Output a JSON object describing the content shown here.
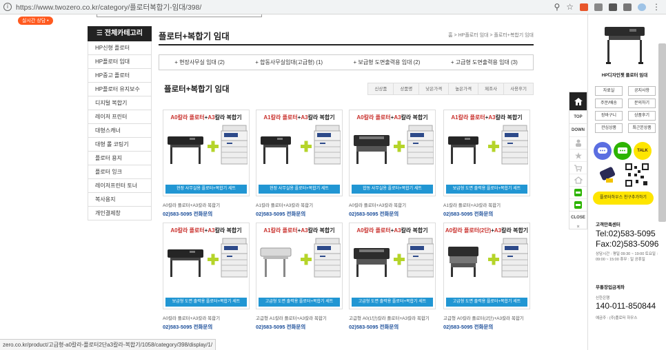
{
  "browser": {
    "url": "https://www.twozero.co.kr/category/플로터복합기-임대/398/"
  },
  "top": {
    "badge": "실시간 상담 •"
  },
  "sidebar": {
    "header": "☰ 전체카테고리",
    "items": [
      "HP신형 플로터",
      "HP플로터 임대",
      "HP중고 플로터",
      "HP플로터 유지보수",
      "디지털 복합기",
      "레이저 프린터",
      "대형스캐너",
      "대형 롤 코팅기",
      "플로터 용지",
      "플로터 잉크",
      "레이저프린터 토너",
      "복사용지",
      "개인결제창"
    ]
  },
  "main": {
    "title": "플로터+복합기 임대",
    "breadcrumb": "홈 > HP플로터 임대 > 플로터+복합기 임대",
    "subcategories": [
      "+ 현장사무실 임대 (2)",
      "+ 합동사무실임대(고급형) (1)",
      "+ 보급형 도면출력용 임대 (2)",
      "+ 고급형 도면출력용 임대 (3)"
    ],
    "list_title": "플로터+복합기 임대",
    "sort_options": [
      "신상품",
      "상품명",
      "낮은가격",
      "높은가격",
      "제조사",
      "사용후기"
    ]
  },
  "products": [
    {
      "t1": "A0칼라 플로터",
      "plus": "+",
      "t2": "A3칼라 복합기",
      "banner": "현장 사무실용 플로터+복합기 세트",
      "name": "A0칼라 플로터+A3칼라 복합기",
      "phone": "02)583-5095 전화문의"
    },
    {
      "t1": "A1칼라 플로터",
      "plus": "+",
      "t2": "A3칼라 복합기",
      "banner": "현장 사무실용 플로터+복합기 세트",
      "name": "A1칼라 플로터+A3칼라 복합기",
      "phone": "02)583-5095 전화문의"
    },
    {
      "t1": "A0칼라 플로터",
      "plus": "+",
      "t2": "A3칼라 복합기",
      "banner": "합동 사무실용 플로터+복합기 세트",
      "name": "A0칼라 플로터+A3칼라 복합기",
      "phone": "02)583-5095 전화문의"
    },
    {
      "t1": "A1칼라 플로터",
      "plus": "+",
      "t2": "A3칼라 복합기",
      "banner": "보급형 도면 출력용 플로터+복합기 세트",
      "name": "A1칼라 플로터+A3칼라 복합기",
      "phone": "02)583-5095 전화문의"
    },
    {
      "t1": "A0칼라 플로터",
      "plus": "+",
      "t2": "A3칼라 복합기",
      "banner": "보급형 도면 출력용 플로터+복합기 세트",
      "name": "A0칼라 플로터+A3칼라 복합기",
      "phone": "02)583-5095 전화문의"
    },
    {
      "t1": "A1칼라 플로터",
      "plus": "+",
      "t2": "A3칼라 복합기",
      "banner": "고급형 도면 출력용 플로터+복합기 세트",
      "name": "고급형 A1칼라 플로터+A3칼라 복합기",
      "phone": "02)583-5095 전화문의"
    },
    {
      "t1": "A0칼라 플로터",
      "plus": "+",
      "t2": "A3칼라 복합기",
      "banner": "고급형 도면 출력용 플로터+복합기 세트",
      "name": "고급형 A0(1단)칼라 플로터+A3칼라 복합기",
      "phone": "02)583-5095 전화문의"
    },
    {
      "t1": "A0칼라 플로터(2단)",
      "plus": "+",
      "t2": "A3칼라 복합기",
      "banner": "고급형 도면 출력용 플로터+복합기 세트",
      "name": "고급형 A0칼라 플로터(2단)+A3칼라 복합기",
      "phone": "02)583-5095 전화문의"
    }
  ],
  "quicknav": {
    "top": "TOP",
    "down": "DOWN",
    "close": "CLOSE"
  },
  "right": {
    "product_name": "HP디자인젯 플로터 임대",
    "buttons": [
      "자료실",
      "공지사항",
      "주문/배송",
      "문의하기",
      "장바구니",
      "상품후기",
      "관심상품",
      "최근본상품"
    ],
    "chat": [
      "TALK"
    ],
    "kakao": "플로터하우스 친구추가하기",
    "cs_title": "고객만족센터",
    "tel": "Tel:02)583-5095",
    "fax": "Fax:02)583-5096",
    "hours": "상담시간 : 평일 09:30 ~ 19:00 토요일 : 09:00 ~ 15:00 휴무 : 일 공휴일",
    "acct_title": "무통장입금계좌",
    "bank": "신한은행",
    "acct_no": "140-011-850844",
    "holder": "예금주 : (주)플로터 하우스"
  },
  "status_url": "zero.co.kr/product/고급형-a0칼라-플로터2단a3칼라-복합기/1058/category/398/display/1/"
}
